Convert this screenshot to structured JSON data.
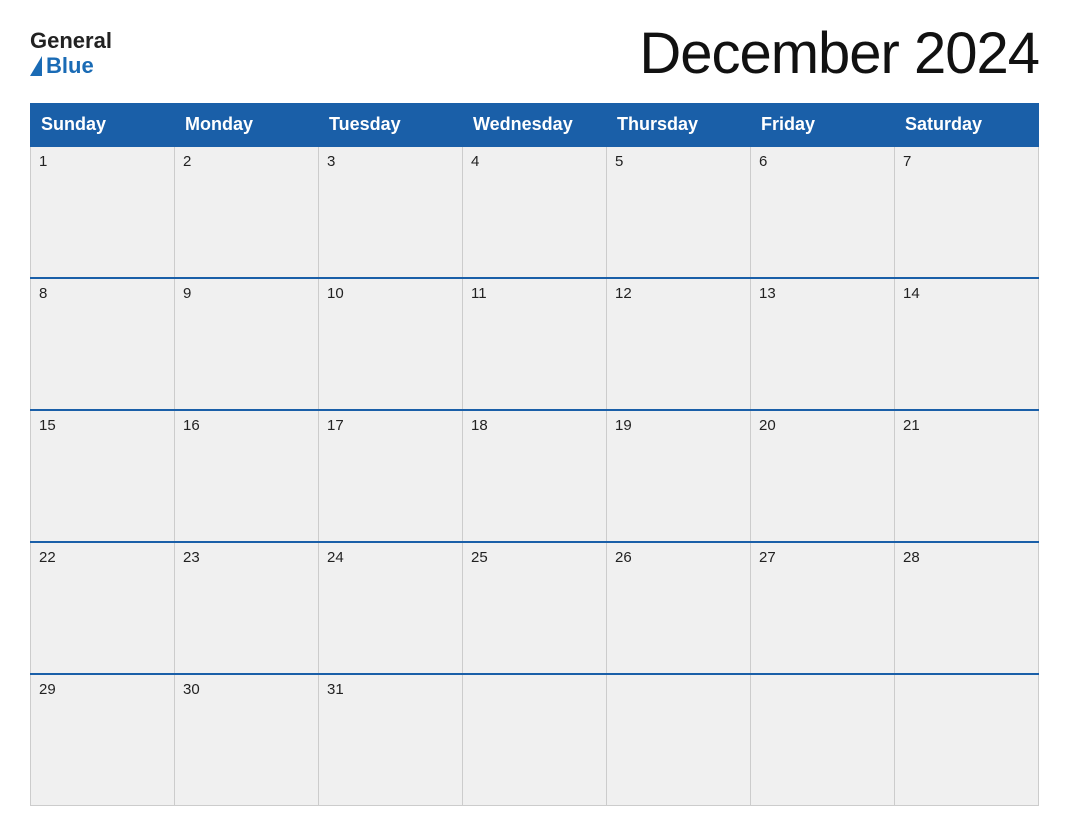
{
  "header": {
    "logo": {
      "general": "General",
      "blue": "Blue"
    },
    "title": "December 2024"
  },
  "calendar": {
    "weekdays": [
      "Sunday",
      "Monday",
      "Tuesday",
      "Wednesday",
      "Thursday",
      "Friday",
      "Saturday"
    ],
    "weeks": [
      [
        {
          "day": "1"
        },
        {
          "day": "2"
        },
        {
          "day": "3"
        },
        {
          "day": "4"
        },
        {
          "day": "5"
        },
        {
          "day": "6"
        },
        {
          "day": "7"
        }
      ],
      [
        {
          "day": "8"
        },
        {
          "day": "9"
        },
        {
          "day": "10"
        },
        {
          "day": "11"
        },
        {
          "day": "12"
        },
        {
          "day": "13"
        },
        {
          "day": "14"
        }
      ],
      [
        {
          "day": "15"
        },
        {
          "day": "16"
        },
        {
          "day": "17"
        },
        {
          "day": "18"
        },
        {
          "day": "19"
        },
        {
          "day": "20"
        },
        {
          "day": "21"
        }
      ],
      [
        {
          "day": "22"
        },
        {
          "day": "23"
        },
        {
          "day": "24"
        },
        {
          "day": "25"
        },
        {
          "day": "26"
        },
        {
          "day": "27"
        },
        {
          "day": "28"
        }
      ],
      [
        {
          "day": "29"
        },
        {
          "day": "30"
        },
        {
          "day": "31"
        },
        {
          "day": ""
        },
        {
          "day": ""
        },
        {
          "day": ""
        },
        {
          "day": ""
        }
      ]
    ]
  }
}
